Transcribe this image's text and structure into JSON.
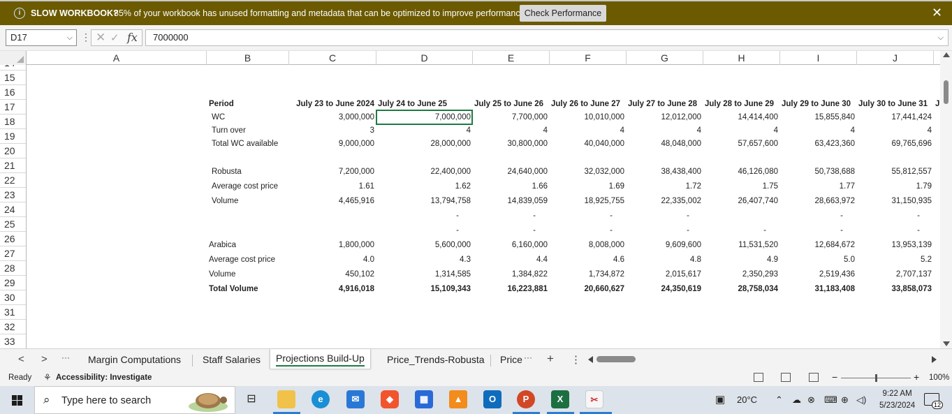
{
  "notification": {
    "title": "SLOW WORKBOOK?",
    "message": "85% of your workbook has unused formatting and metadata that can be optimized to improve performance.",
    "button": "Check Performance",
    "close": "✕"
  },
  "formula_bar": {
    "name_box": "D17",
    "formula_value": "7000000",
    "fx_label": "fx"
  },
  "columns": [
    "A",
    "B",
    "C",
    "D",
    "E",
    "F",
    "G",
    "H",
    "I",
    "J"
  ],
  "rows": [
    "14",
    "15",
    "16",
    "17",
    "18",
    "19",
    "20",
    "21",
    "22",
    "23",
    "24",
    "25",
    "26",
    "27",
    "28",
    "29",
    "30",
    "31",
    "32",
    "33"
  ],
  "sheet": {
    "header": {
      "label": "Period",
      "periods": [
        "July 23 to June 2024",
        "July 24 to June 25",
        "July 25 to June 26",
        "July 26 to June 27",
        "July 27 to June 28",
        "July 28 to June 29",
        "July 29 to June 30",
        "July 30 to June 31",
        "J"
      ]
    },
    "wc": {
      "label": "WC",
      "values": [
        "3,000,000",
        "7,000,000",
        "7,700,000",
        "10,010,000",
        "12,012,000",
        "14,414,400",
        "15,855,840",
        "17,441,424",
        ""
      ]
    },
    "turnover": {
      "label": "Turn over",
      "values": [
        "3",
        "4",
        "4",
        "4",
        "4",
        "4",
        "4",
        "4",
        ""
      ]
    },
    "total_wc": {
      "label": "Total WC available",
      "values": [
        "9,000,000",
        "28,000,000",
        "30,800,000",
        "40,040,000",
        "48,048,000",
        "57,657,600",
        "63,423,360",
        "69,765,696",
        ""
      ]
    },
    "robusta": {
      "label": "Robusta",
      "values": [
        "7,200,000",
        "22,400,000",
        "24,640,000",
        "32,032,000",
        "38,438,400",
        "46,126,080",
        "50,738,688",
        "55,812,557",
        ""
      ]
    },
    "robusta_avg": {
      "label": "Average cost price",
      "values": [
        "1.61",
        "1.62",
        "1.66",
        "1.69",
        "1.72",
        "1.75",
        "1.77",
        "1.79",
        ""
      ]
    },
    "robusta_vol": {
      "label": "Volume",
      "values": [
        "4,465,916",
        "13,794,758",
        "14,839,059",
        "18,925,755",
        "22,335,002",
        "26,407,740",
        "28,663,972",
        "31,150,935",
        ""
      ]
    },
    "row24": {
      "values": [
        "",
        "-",
        "-",
        "-",
        "-",
        "",
        "-",
        "-",
        ""
      ]
    },
    "row25": {
      "values": [
        "",
        "-",
        "-",
        "-",
        "-",
        "-",
        "-",
        "-",
        ""
      ]
    },
    "arabica": {
      "label": "Arabica",
      "values": [
        "1,800,000",
        "5,600,000",
        "6,160,000",
        "8,008,000",
        "9,609,600",
        "11,531,520",
        "12,684,672",
        "13,953,139",
        ""
      ]
    },
    "arabica_avg": {
      "label": "Average cost price",
      "values": [
        "4.0",
        "4.3",
        "4.4",
        "4.6",
        "4.8",
        "4.9",
        "5.0",
        "5.2",
        ""
      ]
    },
    "arabica_vol": {
      "label": "Volume",
      "values": [
        "450,102",
        "1,314,585",
        "1,384,822",
        "1,734,872",
        "2,015,617",
        "2,350,293",
        "2,519,436",
        "2,707,137",
        ""
      ]
    },
    "total_volume": {
      "label": "Total Volume",
      "values": [
        "4,916,018",
        "15,109,343",
        "16,223,881",
        "20,660,627",
        "24,350,619",
        "28,758,034",
        "31,183,408",
        "33,858,073",
        ""
      ]
    }
  },
  "tabs": {
    "prev": "<",
    "next": ">",
    "more": "···",
    "items": [
      "Margin Computations",
      "Staff Salaries",
      "Projections Build-Up",
      "Price_Trends-Robusta",
      "Price"
    ],
    "active_index": 2,
    "overflow": "···",
    "add": "+",
    "options": "⋮"
  },
  "status": {
    "ready": "Ready",
    "accessibility": "Accessibility: Investigate",
    "zoom_minus": "−",
    "zoom_plus": "+",
    "zoom": "100%"
  },
  "taskbar": {
    "search_placeholder": "Type here to search",
    "weather": "20°C",
    "time": "9:22 AM",
    "date": "5/23/2024",
    "notifications": "12",
    "apps": [
      "task-view",
      "file-explorer",
      "edge",
      "mail",
      "brave",
      "microsoft-store",
      "vlc",
      "outlook",
      "powerpoint",
      "excel",
      "snipping-tool"
    ]
  }
}
